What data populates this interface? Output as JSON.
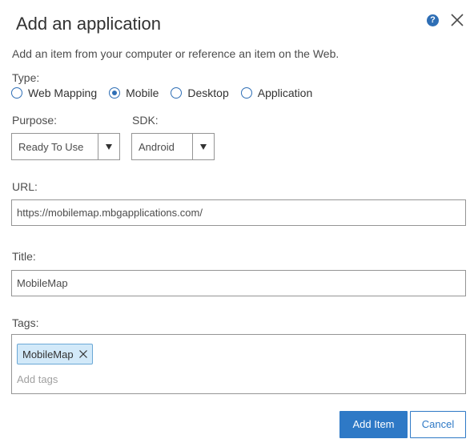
{
  "dialog": {
    "title": "Add an application",
    "description": "Add an item from your computer or reference an item on the Web."
  },
  "type": {
    "label": "Type:",
    "options": [
      {
        "label": "Web Mapping",
        "selected": false
      },
      {
        "label": "Mobile",
        "selected": true
      },
      {
        "label": "Desktop",
        "selected": false
      },
      {
        "label": "Application",
        "selected": false
      }
    ]
  },
  "purpose": {
    "label": "Purpose:",
    "value": "Ready To Use"
  },
  "sdk": {
    "label": "SDK:",
    "value": "Android"
  },
  "url": {
    "label": "URL:",
    "value": "https://mobilemap.mbgapplications.com/"
  },
  "title_field": {
    "label": "Title:",
    "value": "MobileMap"
  },
  "tags": {
    "label": "Tags:",
    "items": [
      "MobileMap"
    ],
    "placeholder": "Add tags"
  },
  "buttons": {
    "add": "Add Item",
    "cancel": "Cancel"
  },
  "icons": {
    "help": "?",
    "close": "close-icon",
    "tag_remove": "close-icon"
  },
  "colors": {
    "accent": "#2e79c6",
    "tag_bg": "#d2e9f9"
  }
}
